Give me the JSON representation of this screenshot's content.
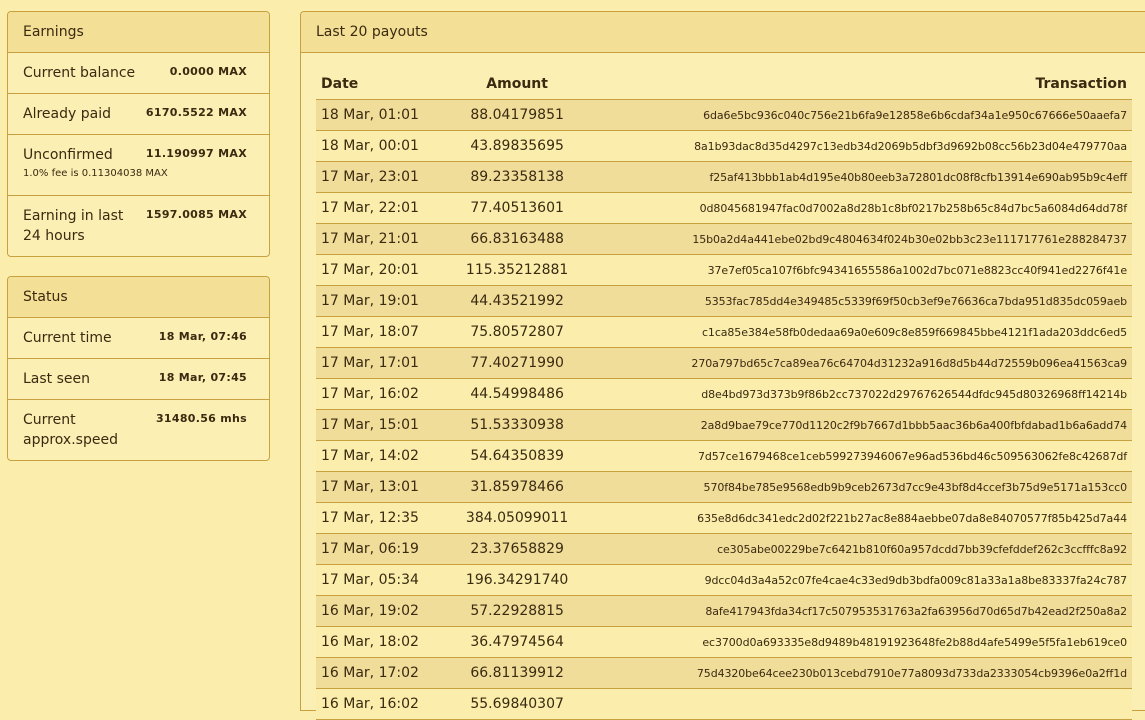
{
  "earnings": {
    "title": "Earnings",
    "rows": [
      {
        "label": "Current balance",
        "value": "0.0000 MAX"
      },
      {
        "label": "Already paid",
        "value": "6170.5522 MAX"
      },
      {
        "label": "Unconfirmed",
        "value": "11.190997 MAX",
        "sub": "1.0% fee is 0.11304038 MAX"
      },
      {
        "label": "Earning in last 24 hours",
        "value": "1597.0085 MAX"
      }
    ]
  },
  "status": {
    "title": "Status",
    "rows": [
      {
        "label": "Current time",
        "value": "18 Mar, 07:46"
      },
      {
        "label": "Last seen",
        "value": "18 Mar, 07:45"
      },
      {
        "label": "Current approx.speed",
        "value": "31480.56 mhs"
      }
    ]
  },
  "payouts": {
    "title": "Last 20 payouts",
    "columns": [
      "Date",
      "Amount",
      "Transaction"
    ],
    "rows": [
      [
        "18 Mar, 01:01",
        "88.04179851",
        "6da6e5bc936c040c756e21b6fa9e12858e6b6cdaf34a1e950c67666e50aaefa7"
      ],
      [
        "18 Mar, 00:01",
        "43.89835695",
        "8a1b93dac8d35d4297c13edb34d2069b5dbf3d9692b08cc56b23d04e479770aa"
      ],
      [
        "17 Mar, 23:01",
        "89.23358138",
        "f25af413bbb1ab4d195e40b80eeb3a72801dc08f8cfb13914e690ab95b9c4eff"
      ],
      [
        "17 Mar, 22:01",
        "77.40513601",
        "0d8045681947fac0d7002a8d28b1c8bf0217b258b65c84d7bc5a6084d64dd78f"
      ],
      [
        "17 Mar, 21:01",
        "66.83163488",
        "15b0a2d4a441ebe02bd9c4804634f024b30e02bb3c23e111717761e288284737"
      ],
      [
        "17 Mar, 20:01",
        "115.35212881",
        "37e7ef05ca107f6bfc94341655586a1002d7bc071e8823cc40f941ed2276f41e"
      ],
      [
        "17 Mar, 19:01",
        "44.43521992",
        "5353fac785dd4e349485c5339f69f50cb3ef9e76636ca7bda951d835dc059aeb"
      ],
      [
        "17 Mar, 18:07",
        "75.80572807",
        "c1ca85e384e58fb0dedaa69a0e609c8e859f669845bbe4121f1ada203ddc6ed5"
      ],
      [
        "17 Mar, 17:01",
        "77.40271990",
        "270a797bd65c7ca89ea76c64704d31232a916d8d5b44d72559b096ea41563ca9"
      ],
      [
        "17 Mar, 16:02",
        "44.54998486",
        "d8e4bd973d373b9f86b2cc737022d29767626544dfdc945d80326968ff14214b"
      ],
      [
        "17 Mar, 15:01",
        "51.53330938",
        "2a8d9bae79ce770d1120c2f9b7667d1bbb5aac36b6a400fbfdabad1b6a6add74"
      ],
      [
        "17 Mar, 14:02",
        "54.64350839",
        "7d57ce1679468ce1ceb599273946067e96ad536bd46c509563062fe8c42687df"
      ],
      [
        "17 Mar, 13:01",
        "31.85978466",
        "570f84be785e9568edb9b9ceb2673d7cc9e43bf8d4ccef3b75d9e5171a153cc0"
      ],
      [
        "17 Mar, 12:35",
        "384.05099011",
        "635e8d6dc341edc2d02f221b27ac8e884aebbe07da8e84070577f85b425d7a44"
      ],
      [
        "17 Mar, 06:19",
        "23.37658829",
        "ce305abe00229be7c6421b810f60a957dcdd7bb39cfefddef262c3ccfffc8a92"
      ],
      [
        "17 Mar, 05:34",
        "196.34291740",
        "9dcc04d3a4a52c07fe4cae4c33ed9db3bdfa009c81a33a1a8be83337fa24c787"
      ],
      [
        "16 Mar, 19:02",
        "57.22928815",
        "8afe417943fda34cf17c507953531763a2fa63956d70d65d7b42ead2f250a8a2"
      ],
      [
        "16 Mar, 18:02",
        "36.47974564",
        "ec3700d0a693335e8d9489b48191923648fe2b88d4afe5499e5f5fa1eb619ce0"
      ],
      [
        "16 Mar, 17:02",
        "66.81139912",
        "75d4320be64cee230b013cebd7910e77a8093d733da2333054cb9396e0a2ff1d"
      ],
      [
        "16 Mar, 16:02",
        "55.69840307",
        ""
      ]
    ]
  }
}
